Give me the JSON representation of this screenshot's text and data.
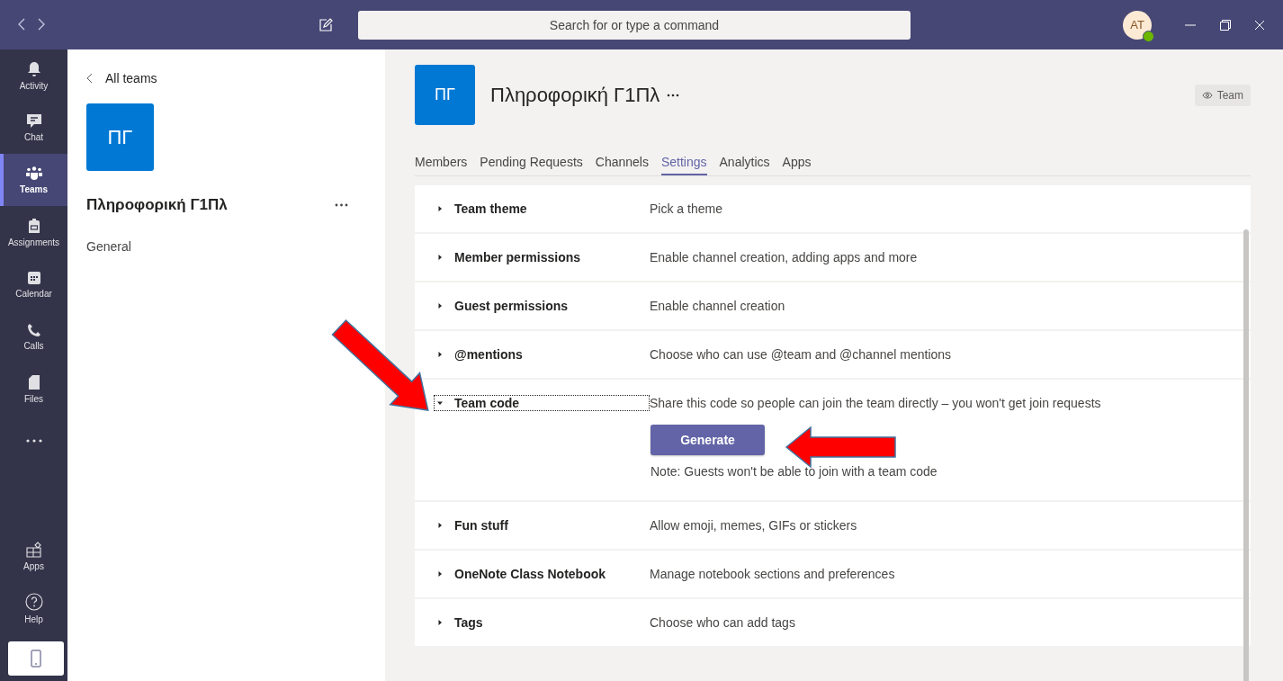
{
  "title_bar": {
    "search": {
      "placeholder": "Search for or type a command"
    },
    "avatar": {
      "initials": "AT",
      "online": true
    }
  },
  "app_bar": {
    "items": [
      {
        "kind": "bell",
        "label": "Activity",
        "selected": false
      },
      {
        "kind": "chat",
        "label": "Chat",
        "selected": false
      },
      {
        "kind": "teams",
        "label": "Teams",
        "selected": true
      },
      {
        "kind": "assignments",
        "label": "Assignments",
        "selected": false
      },
      {
        "kind": "calendar",
        "label": "Calendar",
        "selected": false
      },
      {
        "kind": "calls",
        "label": "Calls",
        "selected": false
      },
      {
        "kind": "files",
        "label": "Files",
        "selected": false
      },
      {
        "kind": "more",
        "selected": false
      }
    ],
    "bottom_items": [
      {
        "kind": "apps",
        "label": "Apps",
        "selected": false
      },
      {
        "kind": "help",
        "label": "Help",
        "selected": false
      }
    ]
  },
  "team_pane": {
    "back_link": "All teams",
    "team_avatar": "ΠΓ",
    "team_name": "Πληροφορική Γ1Πλ",
    "channels": [
      {
        "name": "General",
        "selected": false
      }
    ]
  },
  "team_header": {
    "avatar": "ΠΓ",
    "name": "Πληροφορική Γ1Πλ",
    "view_button": "Team"
  },
  "tabs": [
    {
      "label": "Members",
      "selected": false
    },
    {
      "label": "Pending Requests",
      "selected": false
    },
    {
      "label": "Channels",
      "selected": false
    },
    {
      "label": "Settings",
      "selected": true
    },
    {
      "label": "Analytics",
      "selected": false
    },
    {
      "label": "Apps",
      "selected": false
    }
  ],
  "settings": [
    {
      "title": "Team theme",
      "description": "Pick a theme",
      "expanded": false
    },
    {
      "title": "Member permissions",
      "description": "Enable channel creation, adding apps and more",
      "expanded": false
    },
    {
      "title": "Guest permissions",
      "description": "Enable channel creation",
      "expanded": false
    },
    {
      "title": "@mentions",
      "description": "Choose who can use @team and @channel mentions",
      "expanded": false
    },
    {
      "title": "Team code",
      "description": "Share this code so people can join the team directly – you won't get join requests",
      "expanded": true,
      "focused": true,
      "button": "Generate",
      "note": "Note: Guests won't be able to join with a team code"
    },
    {
      "title": "Fun stuff",
      "description": "Allow emoji, memes, GIFs or stickers",
      "expanded": false
    },
    {
      "title": "OneNote Class Notebook",
      "description": "Manage notebook sections and preferences",
      "expanded": false
    },
    {
      "title": "Tags",
      "description": "Choose who can add tags",
      "expanded": false
    }
  ]
}
